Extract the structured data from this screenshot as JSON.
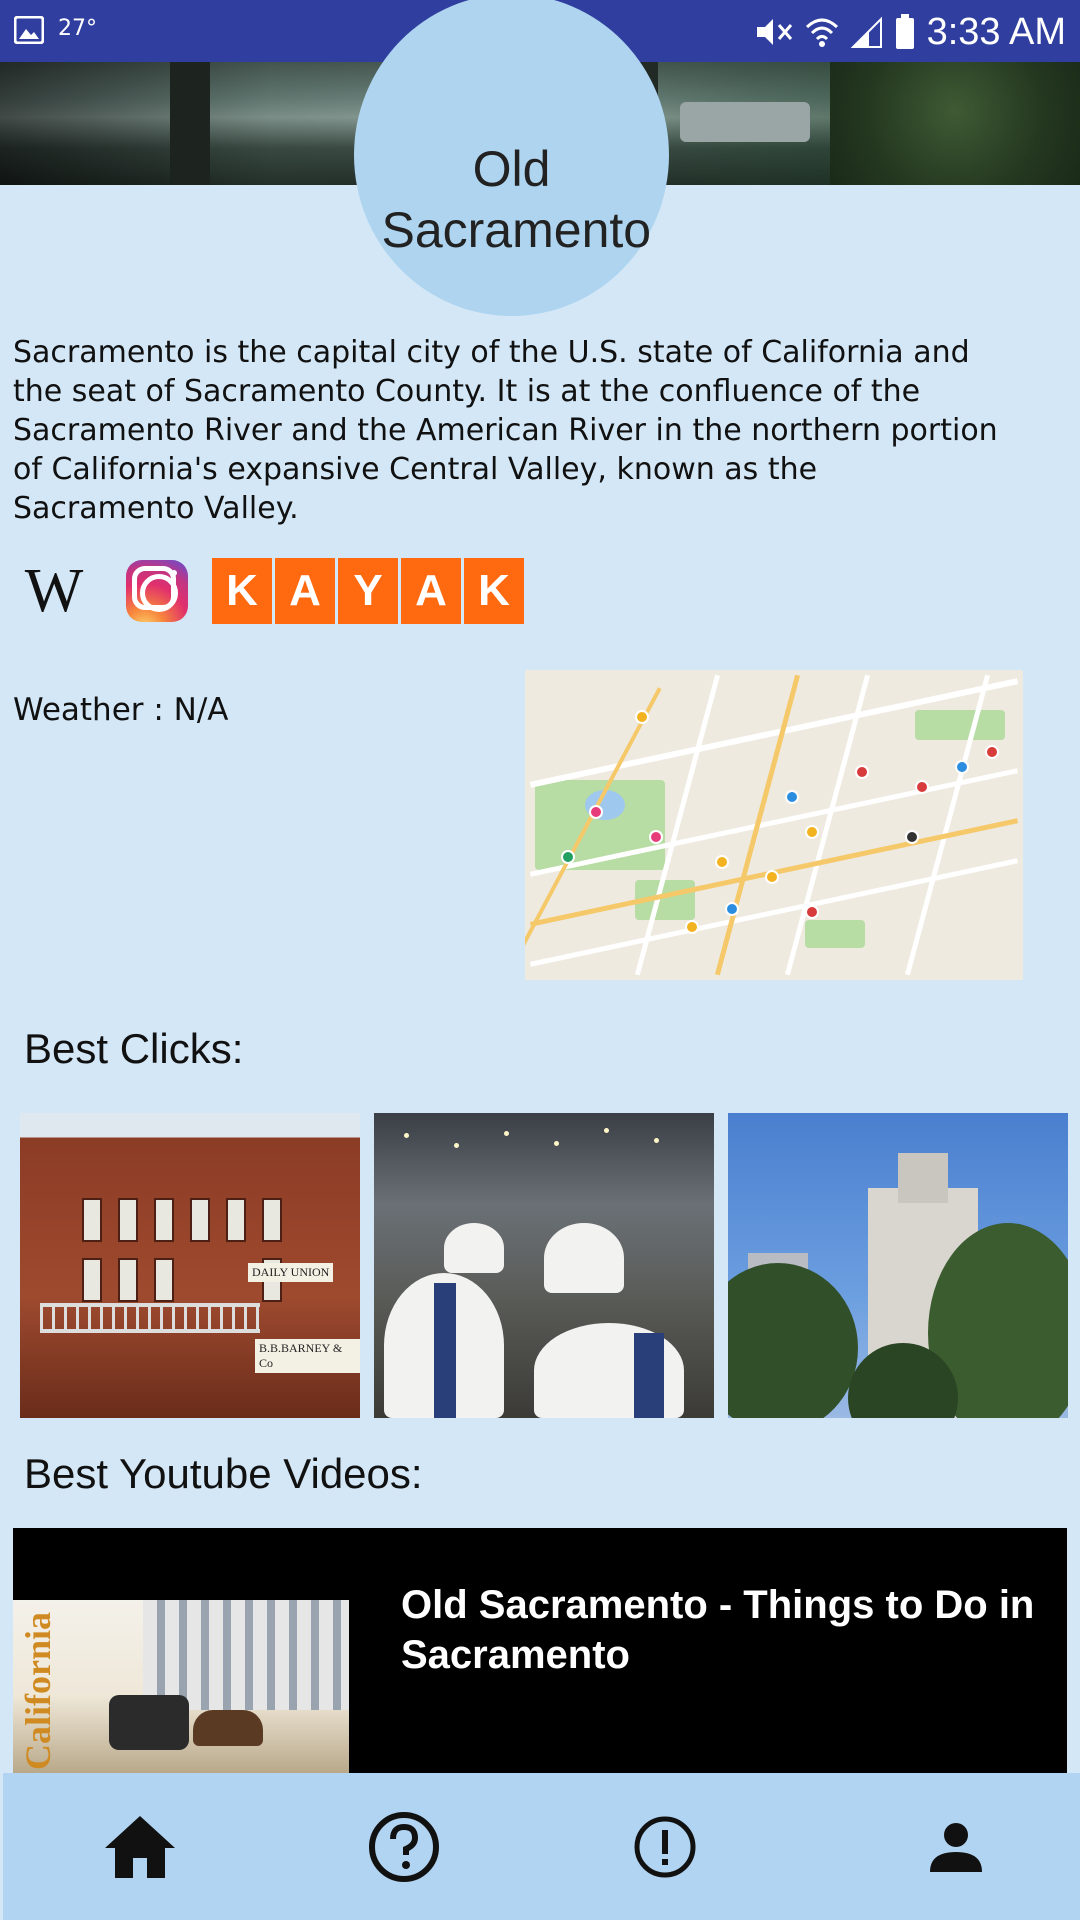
{
  "status_bar": {
    "temperature": "27°",
    "time": "3:33 AM",
    "icons": [
      "image-icon",
      "mute-icon",
      "wifi-icon",
      "signal-icon",
      "battery-icon"
    ]
  },
  "header": {
    "title": "Old Sacramento"
  },
  "description": "Sacramento is the capital city of the U.S. state of California and the seat of Sacramento County. It is at the confluence of the Sacramento River and the American River in the northern portion of California's expansive Central Valley, known as the Sacramento Valley.",
  "links": {
    "wikipedia_icon": "wikipedia-icon",
    "wikipedia_glyph": "W",
    "instagram_icon": "instagram-icon",
    "kayak_letters": [
      "K",
      "A",
      "Y",
      "A",
      "K"
    ],
    "kayak_color": "#ff690f"
  },
  "weather": {
    "text": "Weather : N/A"
  },
  "map": {
    "icon": "map-thumbnail"
  },
  "best_clicks": {
    "heading": "Best Clicks:",
    "photos": [
      "photo-daily-union-building",
      "photo-event-hall",
      "photo-city-buildings"
    ],
    "signs": [
      "DAILY UNION",
      "B.B.BARNEY & Co"
    ]
  },
  "best_videos": {
    "heading": "Best Youtube Videos:",
    "items": [
      {
        "title": "Old Sacramento - Things to Do in Sacramento",
        "thumb_text": "California"
      }
    ]
  },
  "bottom_nav": {
    "items": [
      "home-icon",
      "help-icon",
      "alert-icon",
      "profile-icon"
    ]
  },
  "colors": {
    "background": "#d3e7f6",
    "status_bar": "#303f9f",
    "title_circle": "#aed4f0",
    "bottom_nav": "#b0d4f1"
  }
}
